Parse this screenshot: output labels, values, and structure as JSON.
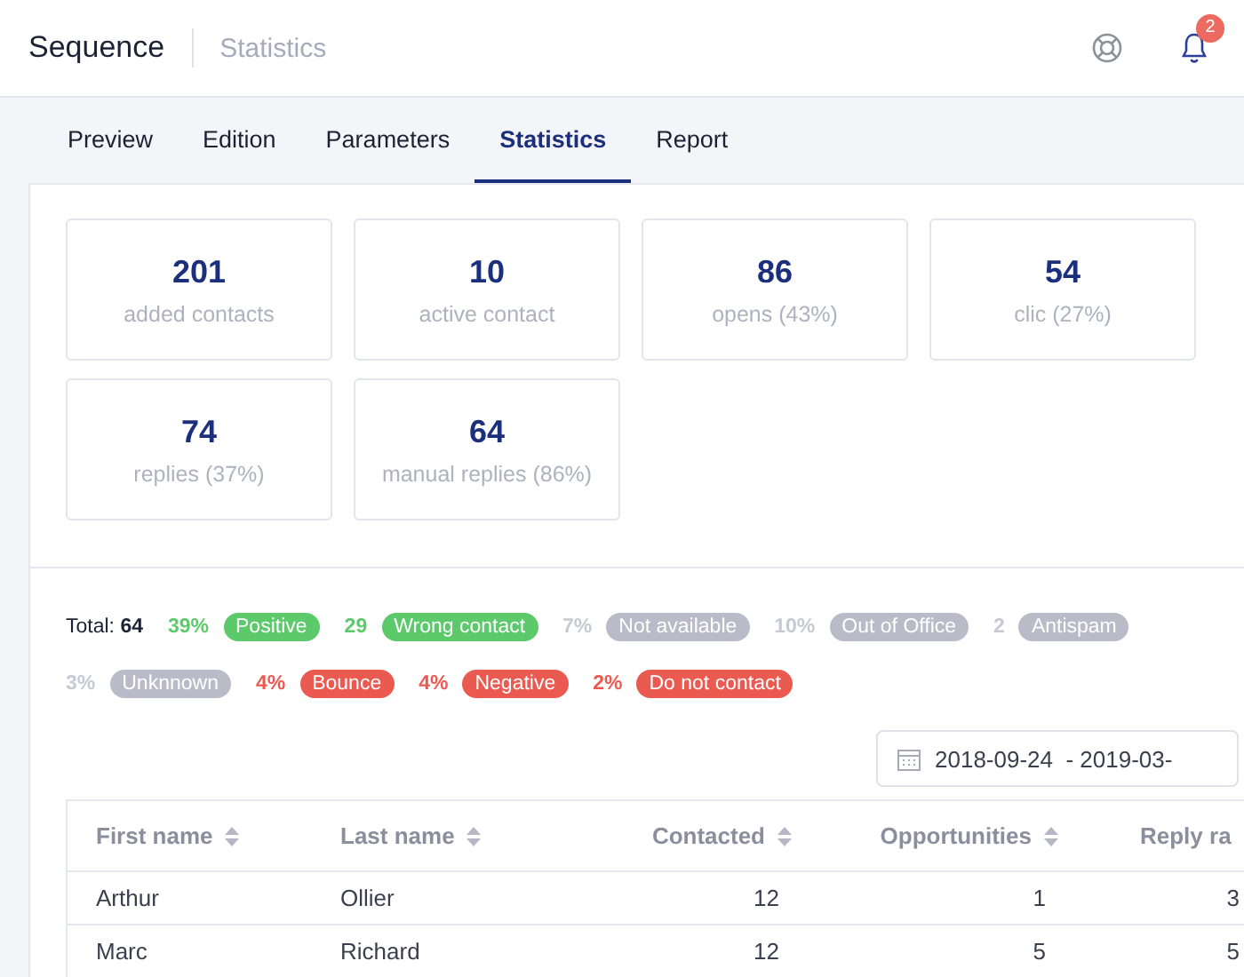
{
  "header": {
    "title": "Sequence",
    "subtitle": "Statistics",
    "notification_count": "2"
  },
  "tabs": [
    {
      "label": "Preview",
      "selected": false
    },
    {
      "label": "Edition",
      "selected": false
    },
    {
      "label": "Parameters",
      "selected": false
    },
    {
      "label": "Statistics",
      "selected": true
    },
    {
      "label": "Report",
      "selected": false
    }
  ],
  "stats": [
    {
      "value": "201",
      "label": "added contacts"
    },
    {
      "value": "10",
      "label": "active contact"
    },
    {
      "value": "86",
      "label": "opens (43%)"
    },
    {
      "value": "54",
      "label": "clic (27%)"
    },
    {
      "value": "74",
      "label": "replies (37%)"
    },
    {
      "value": "64",
      "label": "manual replies (86%)"
    }
  ],
  "summary": {
    "total_label": "Total:",
    "total": "64"
  },
  "tags": [
    {
      "count": "39%",
      "label": "Positive",
      "color": "#5cc96b"
    },
    {
      "count": "29",
      "label": "Wrong contact",
      "color": "#5cc96b"
    },
    {
      "count": "7%",
      "label": "Not available",
      "color": "#b9bcc8"
    },
    {
      "count": "10%",
      "label": "Out of Office",
      "color": "#b9bcc8"
    },
    {
      "count": "2",
      "label": "Antispam",
      "color": "#b9bcc8"
    },
    {
      "count": "3%",
      "label": "Unknnown",
      "color": "#b9bcc8"
    },
    {
      "count": "4%",
      "label": "Bounce",
      "color": "#ea5a50"
    },
    {
      "count": "4%",
      "label": "Negative",
      "color": "#ea5a50"
    },
    {
      "count": "2%",
      "label": "Do not contact",
      "color": "#ea5a50"
    }
  ],
  "date_range": "2018-09-24  - 2019-03-",
  "table": {
    "columns": [
      {
        "label": "First name"
      },
      {
        "label": "Last name"
      },
      {
        "label": "Contacted"
      },
      {
        "label": "Opportunities"
      },
      {
        "label": "Reply ra"
      }
    ],
    "rows": [
      [
        "Arthur",
        "Ollier",
        "12",
        "1",
        "3"
      ],
      [
        "Marc",
        "Richard",
        "12",
        "5",
        "5"
      ]
    ]
  }
}
